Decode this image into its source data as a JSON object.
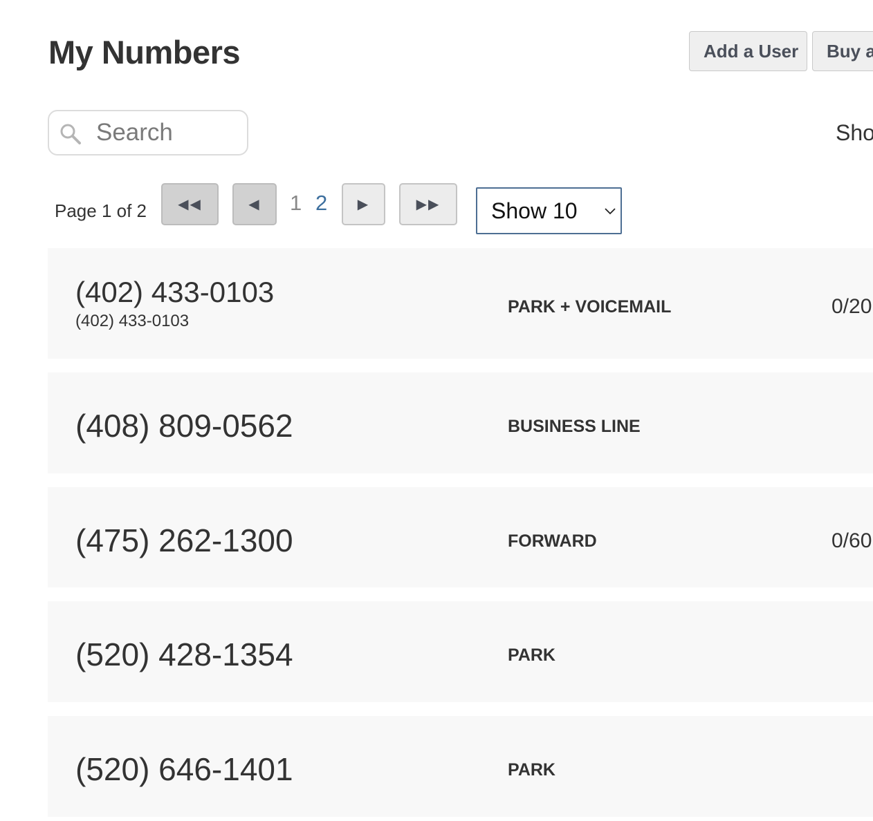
{
  "header": {
    "title": "My Numbers",
    "add_user_label": "Add a User",
    "buy_label": "Buy a"
  },
  "search": {
    "placeholder": "Search",
    "value": ""
  },
  "right_label": "Sho",
  "pagination": {
    "page_text": "Page 1 of 2",
    "first_label": "◀◀",
    "prev_label": "◀",
    "next_label": "▶",
    "last_label": "▶▶",
    "pages": [
      "1",
      "2"
    ],
    "current_page": 1
  },
  "page_size": {
    "selected": "Show 10"
  },
  "numbers": [
    {
      "number": "(402) 433-0103",
      "subtitle": "(402) 433-0103",
      "type": "PARK + VOICEMAIL",
      "usage": "0/20"
    },
    {
      "number": "(408) 809-0562",
      "type": "BUSINESS LINE"
    },
    {
      "number": "(475) 262-1300",
      "type": "FORWARD",
      "usage": "0/60"
    },
    {
      "number": "(520) 428-1354",
      "type": "PARK"
    },
    {
      "number": "(520) 646-1401",
      "type": "PARK"
    }
  ]
}
